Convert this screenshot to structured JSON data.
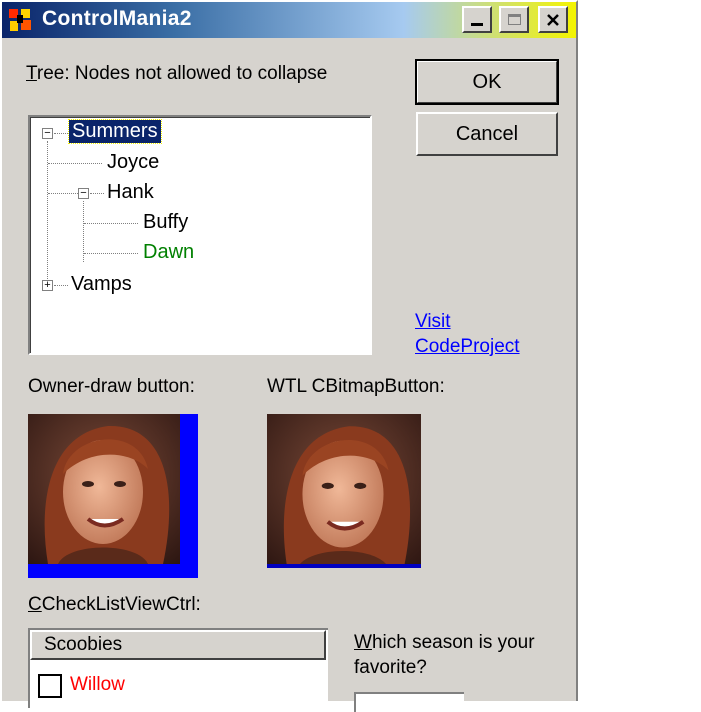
{
  "window": {
    "title": "ControlMania2",
    "controls": [
      "minimize",
      "maximize",
      "close"
    ]
  },
  "tree_label_underline": "T",
  "tree_label_rest": "ree: Nodes not allowed to collapse",
  "buttons": {
    "ok": "OK",
    "cancel": "Cancel"
  },
  "tree": {
    "nodes": [
      {
        "label": "Summers",
        "selected": true,
        "expander": "minus"
      },
      {
        "label": "Joyce"
      },
      {
        "label": "Hank",
        "expander": "minus"
      },
      {
        "label": "Buffy"
      },
      {
        "label": "Dawn",
        "color": "#008000"
      },
      {
        "label": "Vamps",
        "expander": "plus"
      }
    ]
  },
  "link": {
    "line1": "Visit",
    "line2": "CodeProject"
  },
  "owner_draw_label": "Owner-draw button:",
  "wtl_label": "WTL CBitmapButton:",
  "checklist_label_underline": "C",
  "checklist_label_rest": "CheckListViewCtrl:",
  "listview": {
    "header": "Scoobies",
    "rows": [
      {
        "label": "Willow",
        "checked": false,
        "color": "#ff0000"
      }
    ]
  },
  "season_question_underline": "W",
  "season_question_rest": "hich season is your",
  "season_question_line2": "favorite?",
  "colors": {
    "face": "#d6d3ce",
    "selection": "#0a246a",
    "link": "#0000ff",
    "focus_border": "#0000ff"
  }
}
